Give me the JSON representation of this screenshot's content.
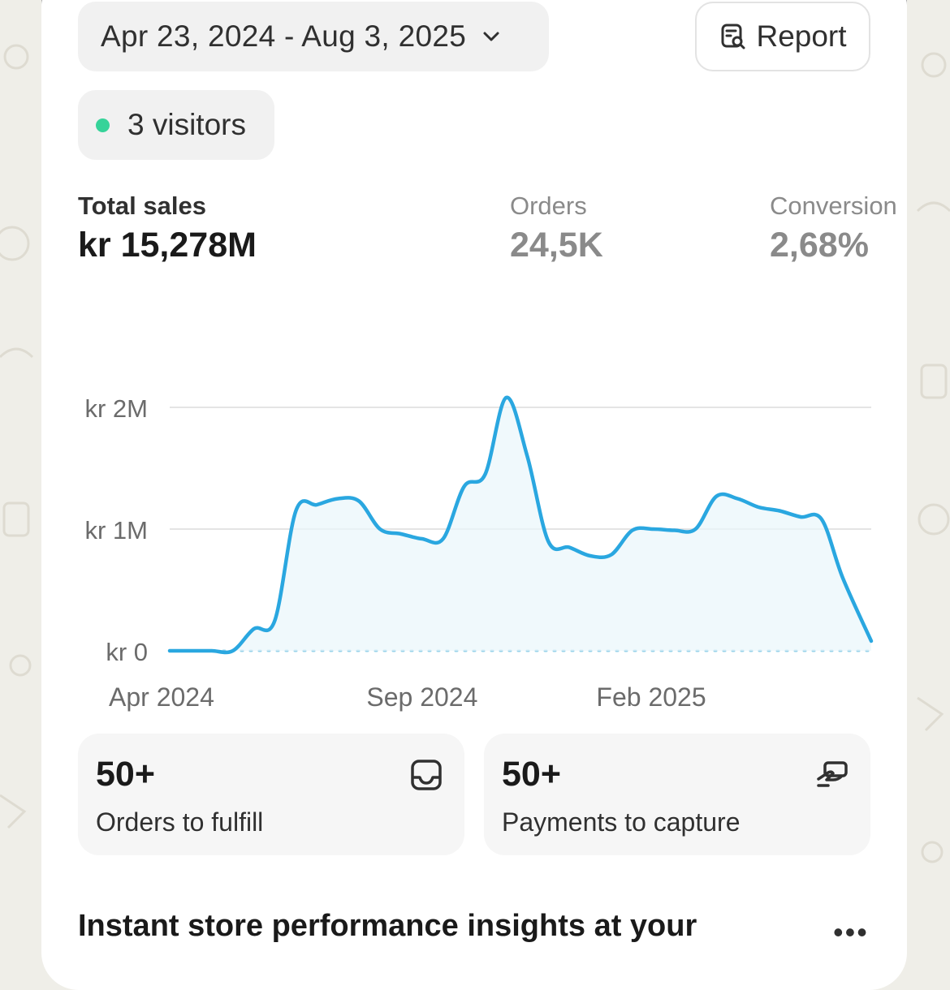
{
  "date_range": {
    "label": "Apr 23, 2024 - Aug 3, 2025"
  },
  "report_button": {
    "label": "Report"
  },
  "visitors": {
    "label": "3 visitors",
    "dot_color": "#36d399"
  },
  "metrics": [
    {
      "label": "Total sales",
      "value": "kr 15,278M"
    },
    {
      "label": "Orders",
      "value": "24,5K"
    },
    {
      "label": "Conversion",
      "value": "2,68%"
    }
  ],
  "chart_data": {
    "type": "line",
    "y_ticks": [
      "kr 0",
      "kr 1M",
      "kr 2M"
    ],
    "x_ticks": [
      "Apr 2024",
      "Sep 2024",
      "Feb 2025"
    ],
    "ylim": [
      0,
      2000000
    ],
    "line_color": "#2aa7e0",
    "baseline_dotted": true,
    "series": [
      {
        "x": [
          "2024-04-23",
          "2024-05-07",
          "2024-05-21",
          "2024-06-04",
          "2024-06-18",
          "2024-07-02",
          "2024-07-16",
          "2024-07-30",
          "2024-08-13",
          "2024-08-27",
          "2024-09-10",
          "2024-09-24",
          "2024-10-08",
          "2024-10-22",
          "2024-11-05",
          "2024-11-19",
          "2024-12-03",
          "2024-12-17",
          "2024-12-31",
          "2025-01-14",
          "2025-01-28",
          "2025-02-11",
          "2025-02-25",
          "2025-03-11",
          "2025-03-25",
          "2025-04-08",
          "2025-04-22",
          "2025-05-06",
          "2025-05-20",
          "2025-06-03",
          "2025-06-17",
          "2025-07-01",
          "2025-07-15",
          "2025-08-03"
        ],
        "values": [
          0,
          0,
          0,
          0,
          180000,
          250000,
          1150000,
          1200000,
          1250000,
          1230000,
          1000000,
          960000,
          920000,
          920000,
          1350000,
          1450000,
          2080000,
          1600000,
          900000,
          850000,
          780000,
          790000,
          990000,
          1000000,
          990000,
          1000000,
          1270000,
          1250000,
          1180000,
          1150000,
          1100000,
          1080000,
          600000,
          80000
        ]
      }
    ]
  },
  "tiles": [
    {
      "count": "50+",
      "label": "Orders to fulfill",
      "icon": "inbox-icon"
    },
    {
      "count": "50+",
      "label": "Payments to capture",
      "icon": "cash-icon"
    }
  ],
  "insights_heading": "Instant store performance insights at your",
  "more_menu": "•••"
}
